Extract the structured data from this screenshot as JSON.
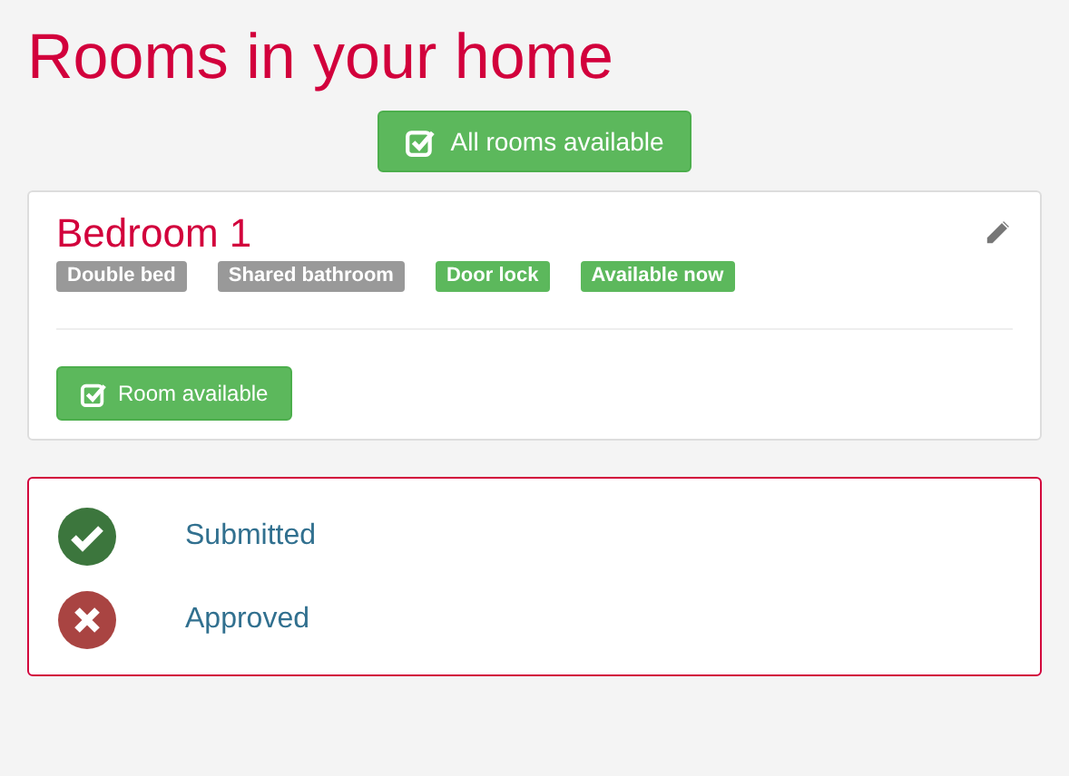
{
  "title": "Rooms in your home",
  "all_rooms_button": {
    "label": "All rooms available"
  },
  "room": {
    "name": "Bedroom 1",
    "tags": [
      {
        "label": "Double bed",
        "color": "#999999"
      },
      {
        "label": "Shared bathroom",
        "color": "#999999"
      },
      {
        "label": "Door lock",
        "color": "#5cb85c"
      },
      {
        "label": "Available now",
        "color": "#5cb85c"
      }
    ],
    "button": {
      "label": "Room available"
    }
  },
  "statuses": [
    {
      "label": "Submitted",
      "done": true
    },
    {
      "label": "Approved",
      "done": false
    }
  ]
}
